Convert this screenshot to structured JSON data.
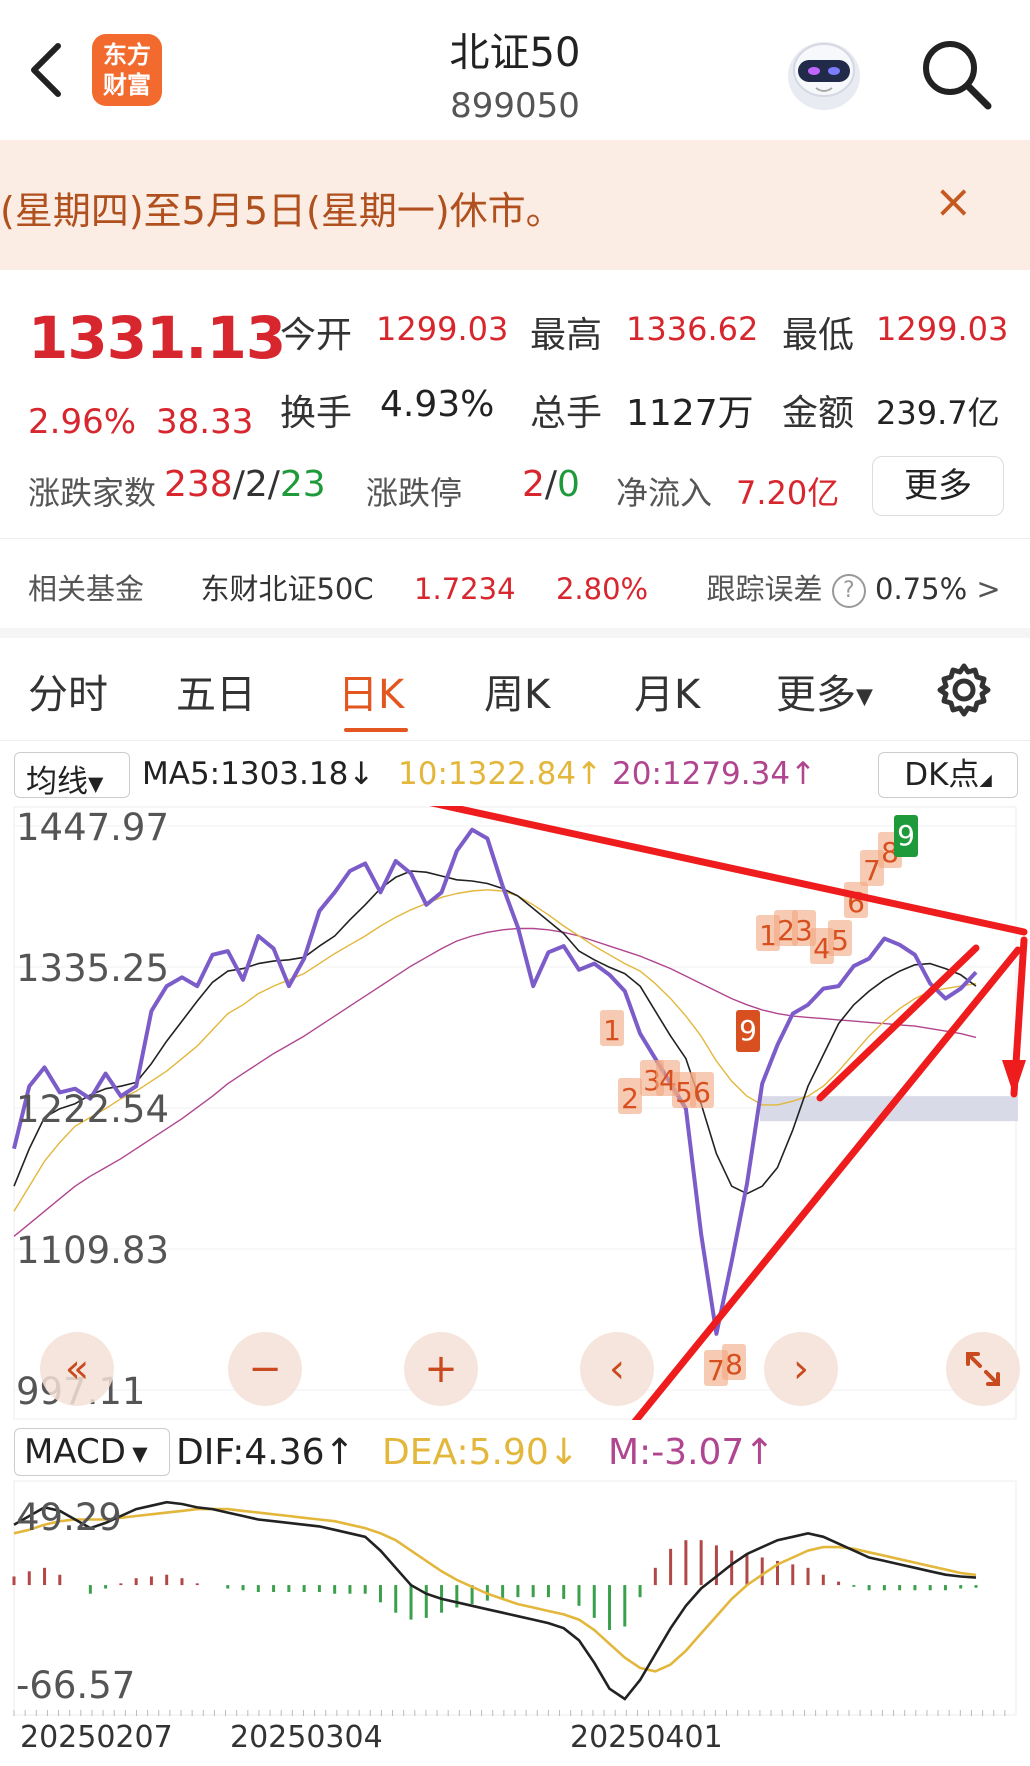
{
  "header": {
    "logo_line1": "东方",
    "logo_line2": "财富",
    "title": "北证50",
    "code": "899050"
  },
  "notice": {
    "text": "(星期四)至5月5日(星期一)休市。",
    "close": "×"
  },
  "quote": {
    "price": "1331.13",
    "change_pct": "2.96%",
    "change_abs": "38.33",
    "open_label": "今开",
    "open": "1299.03",
    "high_label": "最高",
    "high": "1336.62",
    "low_label": "最低",
    "low": "1299.03",
    "turnover_label": "换手",
    "turnover": "4.93%",
    "volume_label": "总手",
    "volume": "1127万",
    "amount_label": "金额",
    "amount": "239.7亿",
    "breadth_label": "涨跌家数",
    "breadth_up": "238",
    "breadth_sep1": "/",
    "breadth_flat": "2",
    "breadth_sep2": "/",
    "breadth_down": "23",
    "limit_label": "涨跌停",
    "limit_up": "2",
    "limit_sep": "/",
    "limit_down": "0",
    "netflow_label": "净流入",
    "netflow": "7.20亿",
    "more_button": "更多"
  },
  "fund": {
    "label": "相关基金",
    "name": "东财北证50C",
    "nav": "1.7234",
    "change": "2.80%",
    "tracking_label": "跟踪误差",
    "tracking_help": "?",
    "tracking_value": "0.75%",
    "chevron": ">"
  },
  "tabs": [
    "分时",
    "五日",
    "日K",
    "周K",
    "月K",
    "更多"
  ],
  "active_tab": "日K",
  "ma_legend": {
    "selector": "均线",
    "ma5": "MA5:1303.18↓",
    "ma10": "10:1322.84↑",
    "ma20": "20:1279.34↑",
    "dk": "DK点"
  },
  "colors": {
    "up": "#d8262e",
    "down": "#1f9a3a",
    "accent": "#e3561f",
    "price_line": "#7b5cc9",
    "ma5": "#222222",
    "ma10": "#e3b73c",
    "ma20": "#b0468f",
    "annotation": "#ee1c1c"
  },
  "chart_data": [
    {
      "type": "line",
      "name": "daily-k",
      "y_ticks": [
        "1447.97",
        "1335.25",
        "1222.54",
        "1109.83",
        "997.11"
      ],
      "ylim": [
        997.11,
        1447.97
      ],
      "x": [
        0,
        1,
        2,
        3,
        4,
        5,
        6,
        7,
        8,
        9,
        10,
        11,
        12,
        13,
        14,
        15,
        16,
        17,
        18,
        19,
        20,
        21,
        22,
        23,
        24,
        25,
        26,
        27,
        28,
        29,
        30,
        31,
        32,
        33,
        34,
        35,
        36,
        37,
        38,
        39,
        40,
        41,
        42,
        43,
        44,
        45,
        46,
        47,
        48,
        49,
        50,
        51,
        52,
        53,
        54,
        55,
        56,
        57,
        58,
        59,
        60,
        61,
        62,
        63
      ],
      "series": [
        {
          "name": "price",
          "values": [
            1190,
            1240,
            1255,
            1235,
            1238,
            1230,
            1250,
            1232,
            1240,
            1300,
            1320,
            1327,
            1320,
            1345,
            1348,
            1325,
            1360,
            1350,
            1320,
            1342,
            1380,
            1395,
            1412,
            1418,
            1395,
            1420,
            1410,
            1385,
            1395,
            1428,
            1445,
            1438,
            1400,
            1367,
            1320,
            1347,
            1352,
            1333,
            1338,
            1329,
            1316,
            1282,
            1262,
            1242,
            1222,
            1122,
            1042,
            1100,
            1162,
            1242,
            1273,
            1298,
            1305,
            1318,
            1320,
            1336,
            1342,
            1358,
            1353,
            1345,
            1322,
            1310,
            1318,
            1331
          ]
        },
        {
          "name": "MA5",
          "values": [
            1160,
            1190,
            1215,
            1222,
            1226,
            1233,
            1238,
            1240,
            1243,
            1258,
            1276,
            1292,
            1308,
            1323,
            1332,
            1334,
            1338,
            1340,
            1341,
            1343,
            1352,
            1360,
            1373,
            1385,
            1398,
            1407,
            1412,
            1411,
            1408,
            1405,
            1404,
            1402,
            1398,
            1392,
            1382,
            1372,
            1362,
            1348,
            1341,
            1335,
            1330,
            1320,
            1300,
            1280,
            1262,
            1226,
            1186,
            1160,
            1154,
            1160,
            1175,
            1205,
            1240,
            1265,
            1290,
            1305,
            1316,
            1325,
            1332,
            1337,
            1338,
            1334,
            1329,
            1320
          ]
        },
        {
          "name": "MA10",
          "values": [
            1140,
            1160,
            1180,
            1195,
            1208,
            1215,
            1222,
            1230,
            1236,
            1244,
            1252,
            1262,
            1272,
            1285,
            1298,
            1305,
            1314,
            1320,
            1325,
            1330,
            1338,
            1346,
            1353,
            1360,
            1368,
            1375,
            1381,
            1386,
            1391,
            1394,
            1396,
            1397,
            1396,
            1392,
            1385,
            1377,
            1368,
            1360,
            1352,
            1345,
            1338,
            1332,
            1322,
            1310,
            1296,
            1280,
            1260,
            1244,
            1232,
            1225,
            1225,
            1228,
            1232,
            1240,
            1252,
            1266,
            1280,
            1292,
            1302,
            1310,
            1316,
            1318,
            1320,
            1322
          ]
        },
        {
          "name": "MA20",
          "values": [
            1120,
            1130,
            1140,
            1150,
            1160,
            1168,
            1175,
            1182,
            1190,
            1198,
            1206,
            1214,
            1223,
            1232,
            1242,
            1250,
            1258,
            1266,
            1273,
            1280,
            1288,
            1296,
            1304,
            1312,
            1320,
            1328,
            1336,
            1343,
            1350,
            1356,
            1360,
            1363,
            1365,
            1366,
            1366,
            1365,
            1363,
            1360,
            1356,
            1352,
            1348,
            1344,
            1339,
            1334,
            1328,
            1322,
            1316,
            1310,
            1305,
            1301,
            1298,
            1296,
            1295,
            1294,
            1293,
            1292,
            1291,
            1290,
            1289,
            1288,
            1286,
            1284,
            1282,
            1279
          ]
        }
      ],
      "markers": [
        {
          "label": "1",
          "i": 45
        },
        {
          "label": "2",
          "i": 46
        },
        {
          "label": "3",
          "i": 47
        },
        {
          "label": "4",
          "i": 48
        },
        {
          "label": "5",
          "i": 49
        },
        {
          "label": "6",
          "i": 50
        },
        {
          "label": "7",
          "i": 52
        },
        {
          "label": "8",
          "i": 53
        },
        {
          "label": "9",
          "i": 54
        },
        {
          "label": "1",
          "i": 51
        },
        {
          "label": "2",
          "i": 52
        },
        {
          "label": "3",
          "i": 53
        },
        {
          "label": "4",
          "i": 55
        },
        {
          "label": "5",
          "i": 56
        },
        {
          "label": "6",
          "i": 57
        },
        {
          "label": "7",
          "i": 58
        },
        {
          "label": "8",
          "i": 59
        },
        {
          "label": "9",
          "i": 60
        }
      ]
    },
    {
      "type": "bar",
      "name": "macd",
      "y_ticks": [
        "49.29",
        "-66.57"
      ],
      "ylim": [
        -66.57,
        49.29
      ],
      "series": [
        {
          "name": "DIF",
          "values": [
            35,
            40,
            45,
            43,
            38,
            33,
            36,
            40,
            44,
            46,
            48,
            47,
            45,
            44,
            42,
            40,
            38,
            37,
            36,
            35,
            34,
            32,
            30,
            28,
            20,
            10,
            0,
            -5,
            -8,
            -10,
            -12,
            -14,
            -16,
            -18,
            -20,
            -22,
            -25,
            -32,
            -45,
            -60,
            -66,
            -55,
            -40,
            -25,
            -12,
            -2,
            5,
            12,
            18,
            22,
            26,
            28,
            30,
            28,
            24,
            20,
            16,
            14,
            12,
            10,
            8,
            6,
            5,
            4.36
          ]
        },
        {
          "name": "DEA",
          "values": [
            30,
            32,
            35,
            37,
            38,
            38,
            38,
            39,
            40,
            41,
            42,
            43,
            44,
            44,
            44,
            43,
            42,
            41,
            40,
            39,
            38,
            37,
            35,
            33,
            30,
            26,
            20,
            14,
            8,
            3,
            -1,
            -5,
            -8,
            -11,
            -13,
            -15,
            -17,
            -20,
            -26,
            -34,
            -42,
            -48,
            -50,
            -46,
            -38,
            -28,
            -18,
            -8,
            0,
            6,
            12,
            16,
            20,
            22,
            22,
            21,
            19,
            17,
            15,
            13,
            11,
            9,
            7,
            5.9
          ]
        }
      ],
      "dif_label": "DIF:4.36↑",
      "dea_label": "DEA:5.90↓",
      "m_label": "M:-3.07↑"
    }
  ],
  "macd_legend": {
    "selector": "MACD",
    "dif": "DIF:4.36↑",
    "dea": "DEA:5.90↓",
    "m": "M:-3.07↑"
  },
  "x_dates": [
    "20250207",
    "20250304",
    "20250401"
  ],
  "controls": {
    "rewind": "«",
    "zoom_out": "−",
    "zoom_in": "+",
    "prev": "‹",
    "next": "›"
  }
}
